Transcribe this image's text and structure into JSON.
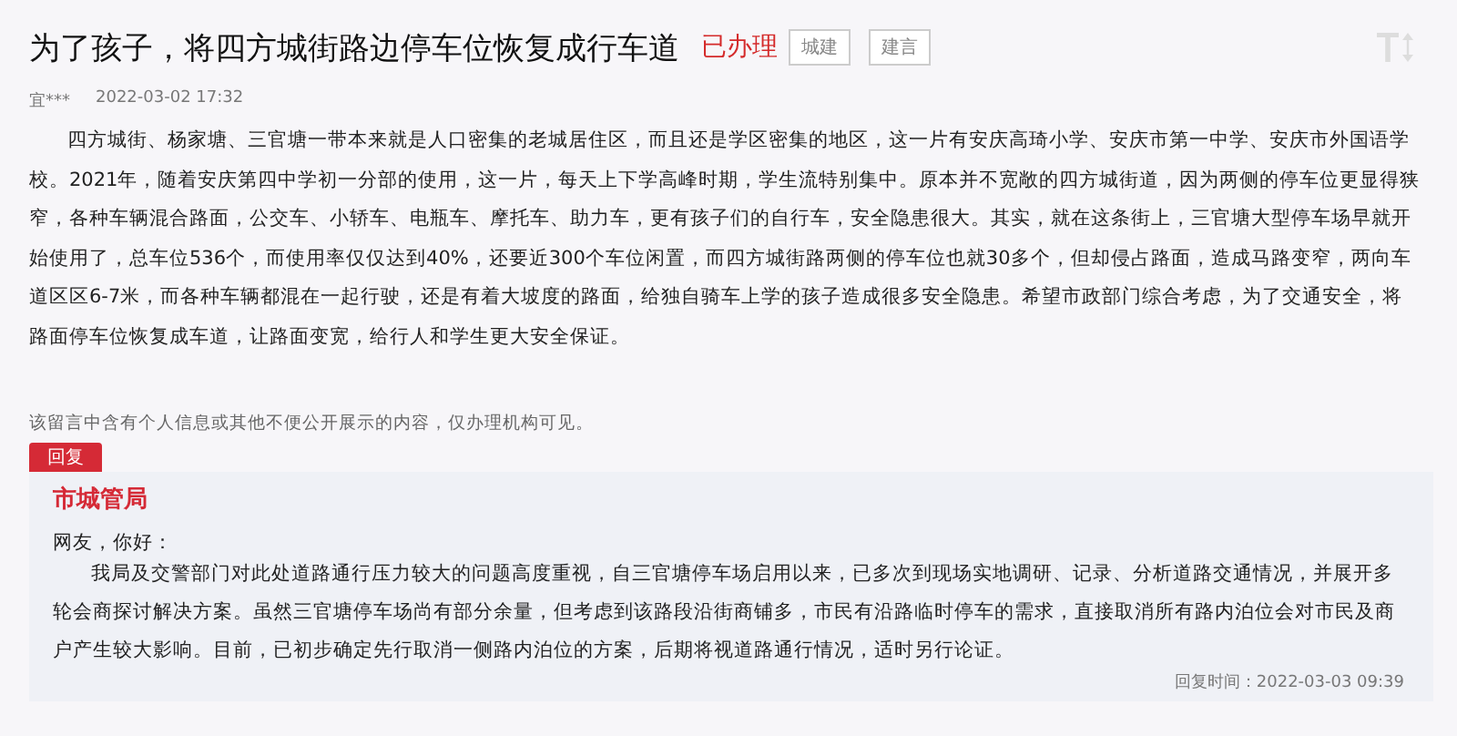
{
  "title": "为了孩子，将四方城街路边停车位恢复成行车道",
  "status": "已办理",
  "tags": [
    "城建",
    "建言"
  ],
  "author": "宜***",
  "posted_at": "2022-03-02 17:32",
  "body": "四方城街、杨家塘、三官塘一带本来就是人口密集的老城居住区，而且还是学区密集的地区，这一片有安庆高琦小学、安庆市第一中学、安庆市外国语学校。2021年，随着安庆第四中学初一分部的使用，这一片，每天上下学高峰时期，学生流特别集中。原本并不宽敞的四方城街道，因为两侧的停车位更显得狭窄，各种车辆混合路面，公交车、小轿车、电瓶车、摩托车、助力车，更有孩子们的自行车，安全隐患很大。其实，就在这条街上，三官塘大型停车场早就开始使用了，总车位536个，而使用率仅仅达到40%，还要近300个车位闲置，而四方城街路两侧的停车位也就30多个，但却侵占路面，造成马路变窄，两向车道区区6-7米，而各种车辆都混在一起行驶，还是有着大坡度的路面，给独自骑车上学的孩子造成很多安全隐患。希望市政部门综合考虑，为了交通安全，将路面停车位恢复成车道，让路面变宽，给行人和学生更大安全保证。",
  "privacy_note": "该留言中含有个人信息或其他不便公开展示的内容，仅办理机构可见。",
  "reply": {
    "tab": "回复",
    "department": "市城管局",
    "greeting": "网友，你好：",
    "body": "我局及交警部门对此处道路通行压力较大的问题高度重视，自三官塘停车场启用以来，已多次到现场实地调研、记录、分析道路交通情况，并展开多轮会商探讨解决方案。虽然三官塘停车场尚有部分余量，但考虑到该路段沿街商铺多，市民有沿路临时停车的需求，直接取消所有路内泊位会对市民及商户产生较大影响。目前，已初步确定先行取消一侧路内泊位的方案，后期将视道路通行情况，适时另行论证。",
    "replied_at": "回复时间：2022-03-03 09:39"
  }
}
